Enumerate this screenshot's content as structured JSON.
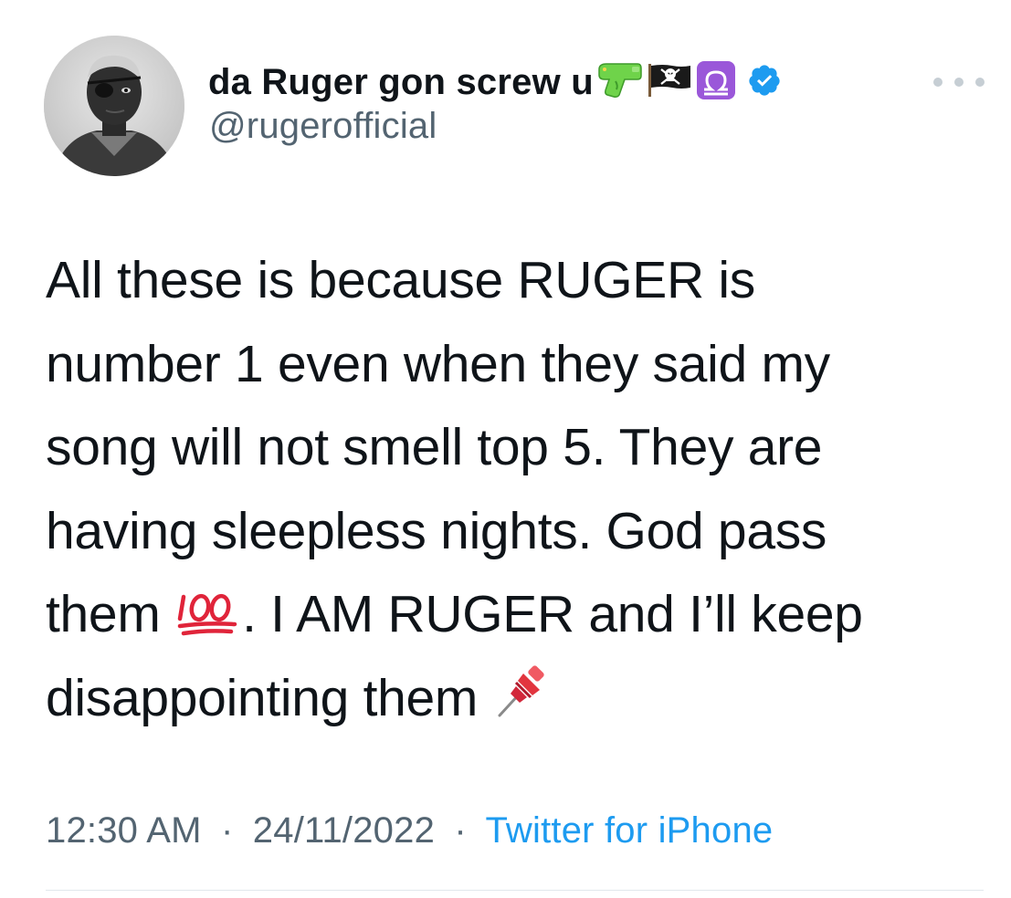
{
  "user": {
    "display_name": "da Ruger gon screw u",
    "handle": "@rugerofficial",
    "name_emojis": [
      "water-pistol-icon",
      "pirate-flag-icon",
      "libra-icon"
    ],
    "verified": true
  },
  "tweet": {
    "lines": [
      "All these is because RUGER is",
      "number 1 even when they said my",
      "song will not smell top 5. They are",
      "having sleepless nights. God pass",
      {
        "before": "them ",
        "emoji": "hundred-points-icon",
        "after": ". I AM RUGER and I’ll keep"
      },
      {
        "before": "disappointing them ",
        "emoji": "pushpin-icon",
        "after": ""
      }
    ],
    "line_5_before": "them ",
    "line_5_after": ". I AM RUGER and I’ll keep",
    "line_6_before": "disappointing them "
  },
  "meta": {
    "time": "12:30 AM",
    "separator": "·",
    "date": "24/11/2022",
    "source": "Twitter for iPhone"
  },
  "colors": {
    "text": "#0f1419",
    "secondary": "#536471",
    "link": "#1d9bf0",
    "verified": "#1d9bf0",
    "divider": "#e1e8ed"
  }
}
